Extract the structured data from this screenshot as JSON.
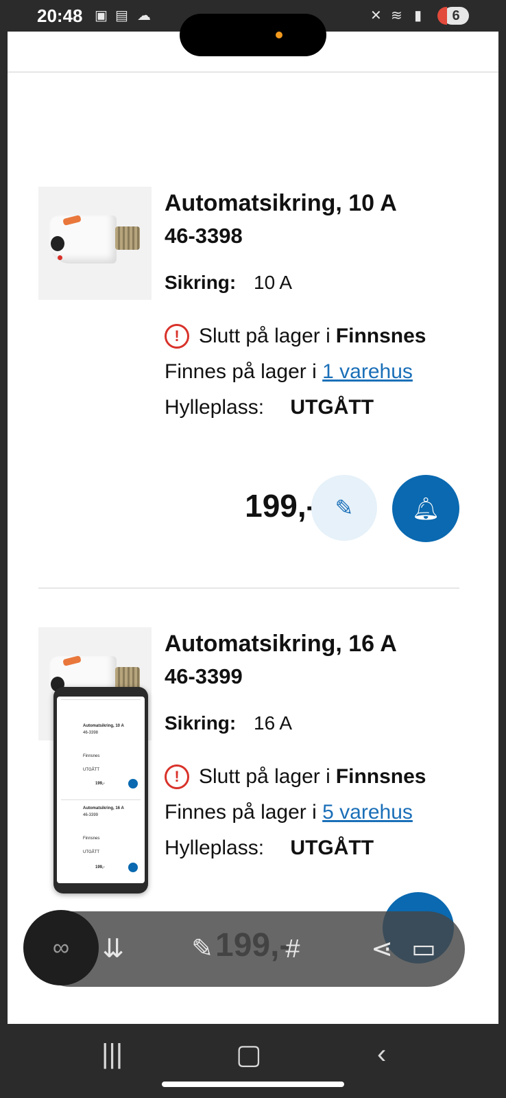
{
  "status_bar": {
    "time": "20:48",
    "battery": "6"
  },
  "products": [
    {
      "title": "Automatsikring, 10 A",
      "sku": "46-3398",
      "spec_key": "Sikring:",
      "spec_value": "10 A",
      "stock_out_prefix": "Slutt på lager i",
      "stock_out_store": "Finnsnes",
      "stock_avail_prefix": "Finnes på lager i",
      "stock_avail_link": "1 varehus",
      "shelf_key": "Hylleplass:",
      "shelf_value": "UTGÅTT",
      "price": "199,-"
    },
    {
      "title": "Automatsikring, 16 A",
      "sku": "46-3399",
      "spec_key": "Sikring:",
      "spec_value": "16 A",
      "stock_out_prefix": "Slutt på lager i",
      "stock_out_store": "Finnsnes",
      "stock_avail_prefix": "Finnes på lager i",
      "stock_avail_link": "5 varehus",
      "shelf_key": "Hylleplass:",
      "shelf_value": "UTGÅTT",
      "price": "199,-"
    }
  ],
  "icons": {
    "warning": "exclamation-circle-icon",
    "edit": "edit-icon",
    "notify": "bell-icon",
    "chat": "chat-bubble-icon"
  },
  "colors": {
    "accent": "#0a69b0",
    "link": "#1a6fb8",
    "warning": "#d8322a",
    "edit_bg": "#e6f1f9"
  }
}
